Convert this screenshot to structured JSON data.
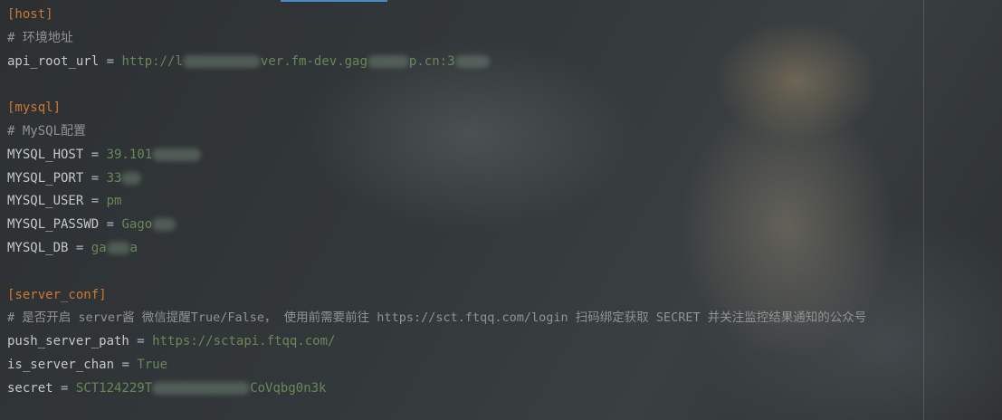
{
  "editor": {
    "host": {
      "section": "[host]",
      "comment": "# 环境地址",
      "api_key": "api_root_url",
      "eq": "=",
      "api_val_a": "http://l",
      "api_val_b": "ver.fm-dev.gag",
      "api_val_c": "p.cn:3"
    },
    "mysql": {
      "section": "[mysql]",
      "comment": "# MySQL配置",
      "host_key": "MYSQL_HOST",
      "host_val": "39.101",
      "port_key": "MYSQL_PORT",
      "port_val": "33",
      "user_key": "MYSQL_USER",
      "user_val": "pm",
      "passwd_key": "MYSQL_PASSWD",
      "passwd_val": "Gago",
      "db_key": "MYSQL_DB",
      "db_val_a": "ga",
      "db_val_b": "a"
    },
    "server_conf": {
      "section": "[server_conf]",
      "comment": "# 是否开启 server酱 微信提醒True/False， 使用前需要前往 https://sct.ftqq.com/login 扫码绑定获取 SECRET 并关注监控结果通知的公众号",
      "push_key": "push_server_path",
      "push_val": "https://sctapi.ftqq.com/",
      "chan_key": "is_server_chan",
      "chan_val": "True",
      "secret_key": "secret",
      "secret_val_a": "SCT124229T",
      "secret_val_b": "CoVqbg0n3k"
    }
  }
}
